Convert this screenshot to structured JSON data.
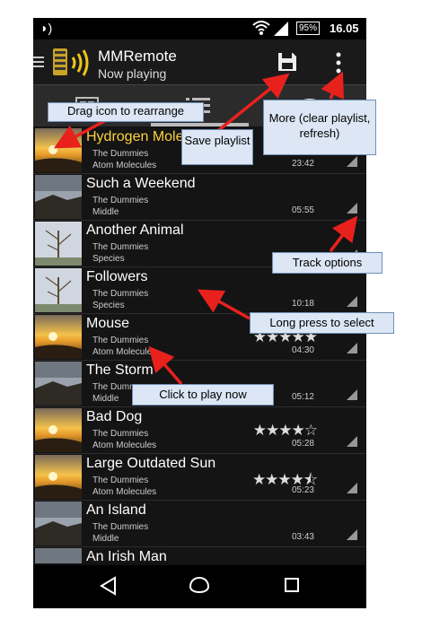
{
  "statusbar": {
    "battery": "95%",
    "time": "16.05"
  },
  "toolbar": {
    "title": "MMRemote",
    "subtitle": "Now playing"
  },
  "tracks": [
    {
      "title": "Hydrogen Mole",
      "artist": "The Dummies",
      "album": "Atom Molecules",
      "duration": "23:42",
      "stars": "★",
      "current": true,
      "thumb": "sunset"
    },
    {
      "title": "Such a Weekend",
      "artist": "The Dummies",
      "album": "Middle",
      "duration": "05:55",
      "stars": "",
      "thumb": "coast"
    },
    {
      "title": "Another Animal",
      "artist": "The Dummies",
      "album": "Species",
      "duration": "",
      "stars": "",
      "thumb": "tree"
    },
    {
      "title": "Followers",
      "artist": "The Dummies",
      "album": "Species",
      "duration": "10:18",
      "stars": "",
      "thumb": "tree"
    },
    {
      "title": "Mouse",
      "artist": "The Dummies",
      "album": "Atom Molecules",
      "duration": "04:30",
      "stars": "★★★★★",
      "thumb": "sunset"
    },
    {
      "title": "The Storm",
      "artist": "The Dumm",
      "album": "Middle",
      "duration": "05:12",
      "stars": "",
      "thumb": "coast"
    },
    {
      "title": "Bad Dog",
      "artist": "The Dummies",
      "album": "Atom Molecules",
      "duration": "05:28",
      "stars": "★★★★☆",
      "thumb": "sunset"
    },
    {
      "title": "Large Outdated Sun",
      "artist": "The Dummies",
      "album": "Atom Molecules",
      "duration": "05:23",
      "stars": "★★★★⯪",
      "thumb": "sunset"
    },
    {
      "title": "An Island",
      "artist": "The Dummies",
      "album": "Middle",
      "duration": "03:43",
      "stars": "",
      "thumb": "coast"
    },
    {
      "title": "An Irish Man",
      "artist": "",
      "album": "",
      "duration": "",
      "stars": "",
      "thumb": "coast"
    }
  ],
  "callouts": {
    "drag": "Drag icon to rearrange",
    "save": "Save playlist",
    "more": "More (clear playlist, refresh)",
    "track_options": "Track options",
    "long_press": "Long press to select",
    "click_play": "Click to play now"
  },
  "colors": {
    "current_track": "#ffd23c",
    "callout_bg": "#dce6f4",
    "arrow": "#e8211d"
  },
  "icons": [
    "signal-icon",
    "wifi-icon",
    "menu-icon",
    "logo-icon",
    "save-icon",
    "more-icon",
    "library-tab-icon",
    "playlist-tab-icon",
    "disc-tab-icon",
    "back-icon",
    "home-icon",
    "recents-icon"
  ]
}
